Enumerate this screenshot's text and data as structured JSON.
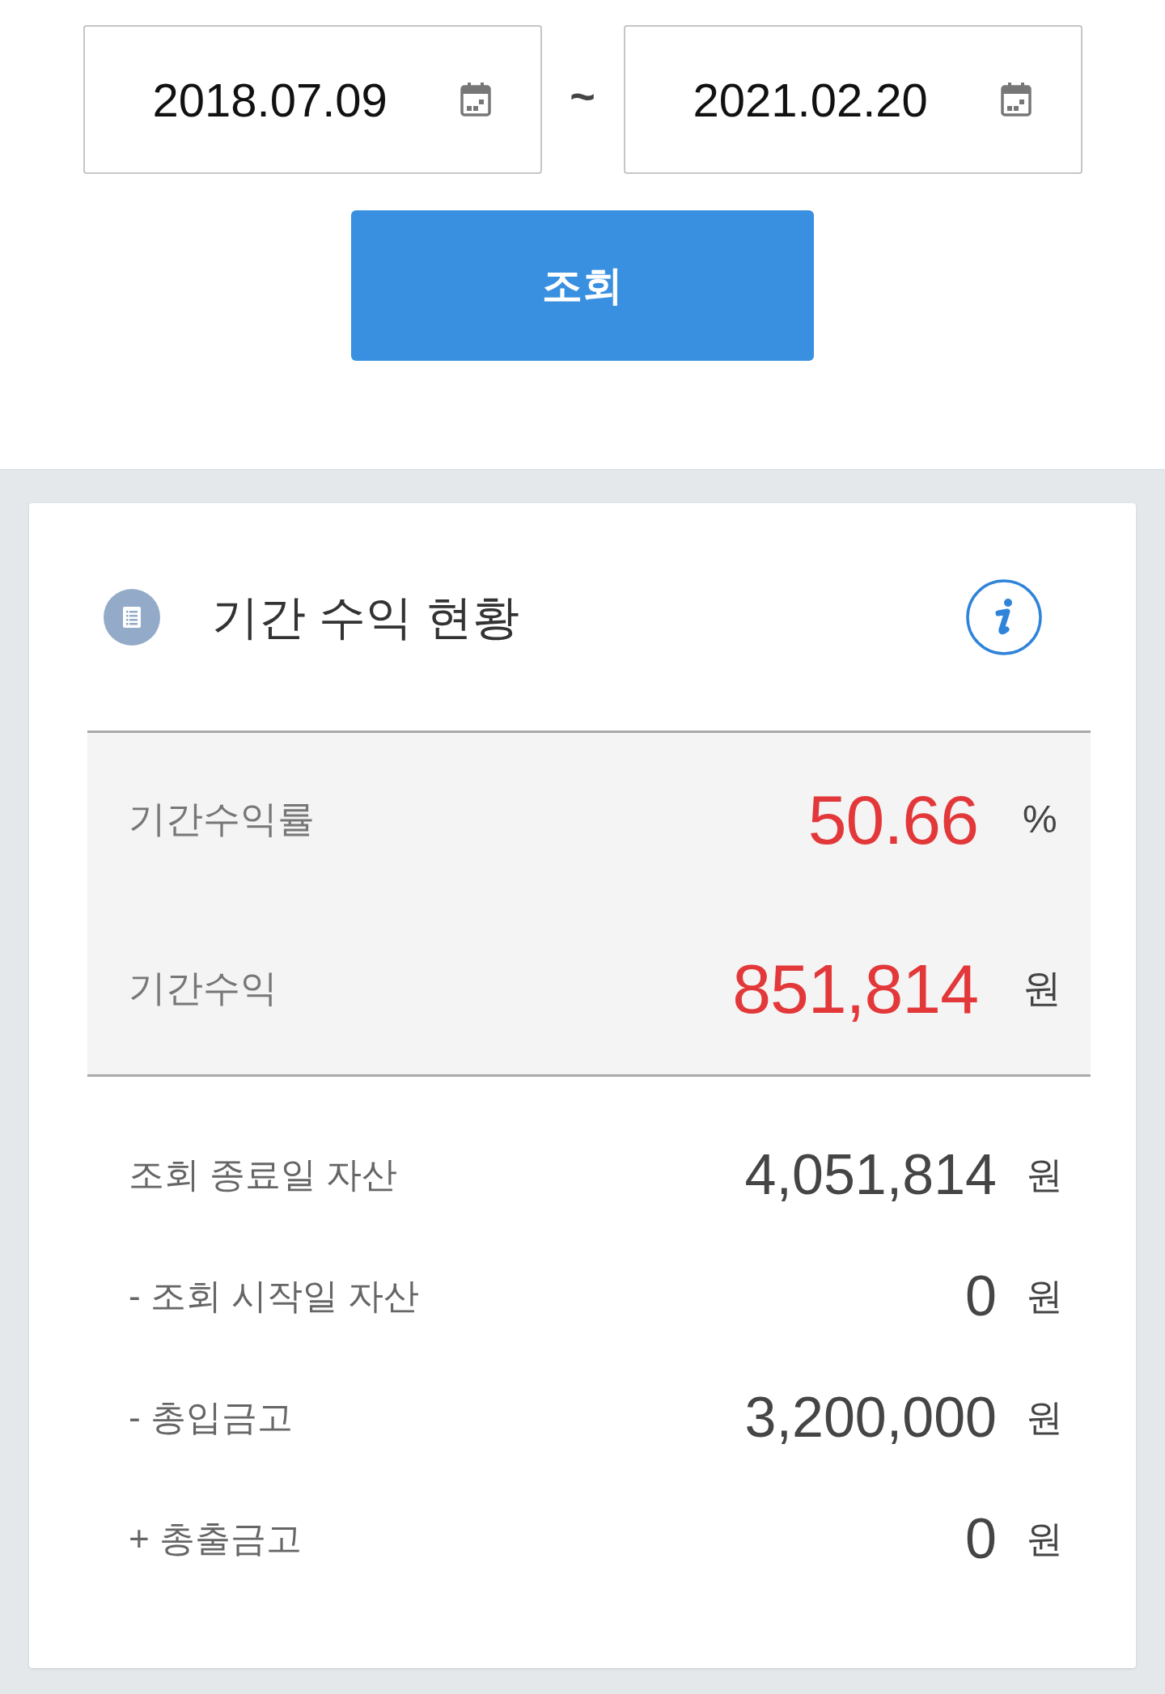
{
  "date_range": {
    "start": {
      "value": "2018.07.09"
    },
    "separator": "~",
    "end": {
      "value": "2021.02.20"
    }
  },
  "search_button": {
    "label": "조회"
  },
  "card": {
    "title": "기간 수익 현황",
    "summary": [
      {
        "label": "기간수익률",
        "value": "50.66",
        "unit": "%"
      },
      {
        "label": "기간수익",
        "value": "851,814",
        "unit": "원"
      }
    ],
    "breakdown": [
      {
        "label": "조회 종료일 자산",
        "value": "4,051,814",
        "unit": "원"
      },
      {
        "label": "- 조회 시작일 자산",
        "value": "0",
        "unit": "원"
      },
      {
        "label": "- 총입금고",
        "value": "3,200,000",
        "unit": "원"
      },
      {
        "label": "+ 총출금고",
        "value": "0",
        "unit": "원"
      }
    ]
  }
}
